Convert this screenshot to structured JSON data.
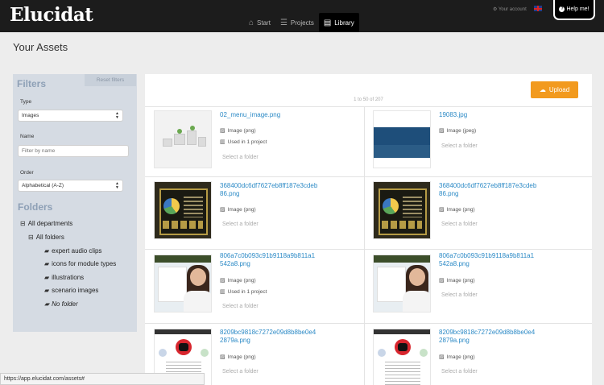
{
  "app": {
    "logo": "Elucidat",
    "nav": [
      {
        "label": "Start",
        "icon": "home-icon"
      },
      {
        "label": "Projects",
        "icon": "list-icon"
      },
      {
        "label": "Library",
        "icon": "book-icon",
        "active": true
      }
    ],
    "account_label": "Your account",
    "language_flag": "uk-flag-icon",
    "help_label": "Help me!"
  },
  "page": {
    "title": "Your Assets"
  },
  "sidebar": {
    "filters_title": "Filters",
    "reset_label": "Reset filters",
    "type_label": "Type",
    "type_value": "Images",
    "name_label": "Name",
    "name_placeholder": "Filter by name",
    "order_label": "Order",
    "order_value": "Alphabetical (A-Z)",
    "folders_title": "Folders",
    "folders": [
      {
        "label": "All departments"
      },
      {
        "label": "All folders"
      },
      {
        "label": "expert audio clips"
      },
      {
        "label": "icons for module types"
      },
      {
        "label": "illustrations"
      },
      {
        "label": "scenario images"
      },
      {
        "label": "No folder"
      }
    ]
  },
  "main": {
    "upload_label": "Upload",
    "pagination": "1 to 50 of 207",
    "assets": [
      {
        "name": "02_menu_image.png",
        "type": "Image (png)",
        "usage": "Used in 1 project",
        "folder": "Select a folder"
      },
      {
        "name": "19083.jpg",
        "type": "Image (jpeg)",
        "usage": "",
        "folder": "Select a folder"
      },
      {
        "name": "368400dc6df7627eb8ff187e3cdeb86.png",
        "type": "Image (png)",
        "usage": "",
        "folder": "Select a folder"
      },
      {
        "name": "368400dc6df7627eb8ff187e3cdeb86.png",
        "type": "Image (png)",
        "usage": "",
        "folder": "Select a folder"
      },
      {
        "name": "806a7c0b093c91b9118a9b811a1542a8.png",
        "type": "Image (png)",
        "usage": "Used in 1 project",
        "folder": "Select a folder"
      },
      {
        "name": "806a7c0b093c91b9118a9b811a1542a8.png",
        "type": "Image (png)",
        "usage": "",
        "folder": "Select a folder"
      },
      {
        "name": "8209bc9818c7272e09d8b8be0e42879a.png",
        "type": "Image (png)",
        "usage": "",
        "folder": "Select a folder"
      },
      {
        "name": "8209bc9818c7272e09d8b8be0e42879a.png",
        "type": "Image (png)",
        "usage": "",
        "folder": "Select a folder"
      }
    ]
  },
  "status_bar": {
    "url": "https://app.elucidat.com/assets#"
  },
  "colors": {
    "navbar": "#1c1c1c",
    "accent_upload": "#f29a1e",
    "link": "#2c8ac6",
    "sidebar": "#d5dbe3",
    "sidebar_heading": "#8ea0b6"
  }
}
